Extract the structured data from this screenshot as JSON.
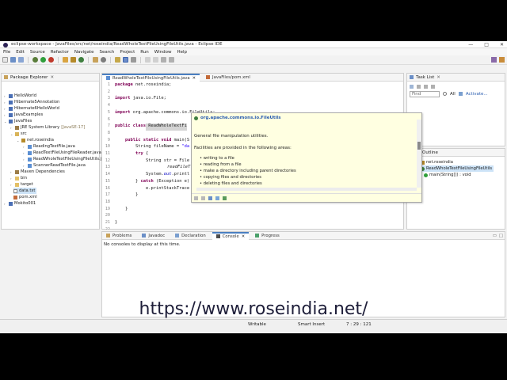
{
  "window": {
    "title": "eclipse-workspace - JavaFiles/src/net/roseindia/ReadWholeTextFileUsingFileUtils.java - Eclipse IDE",
    "controls": [
      "—",
      "□",
      "✕"
    ]
  },
  "menu": [
    "File",
    "Edit",
    "Source",
    "Refactor",
    "Navigate",
    "Search",
    "Project",
    "Run",
    "Window",
    "Help"
  ],
  "package_explorer": {
    "title": "Package Explorer",
    "items": [
      {
        "label": "HelloWorld",
        "decor": ""
      },
      {
        "label": "Hibernate5Annotation",
        "decor": ""
      },
      {
        "label": "Hibernate6HelloWorld",
        "decor": ""
      },
      {
        "label": "JavaExamples",
        "decor": ""
      },
      {
        "label": "JavaFiles",
        "decor": ""
      },
      {
        "label": "JRE System Library",
        "decor": "[JavaSE-17]"
      },
      {
        "label": "src",
        "decor": ""
      },
      {
        "label": "net.roseindia",
        "decor": ""
      },
      {
        "label": "ReadingTextFile.java",
        "decor": ""
      },
      {
        "label": "ReadTextFileUsingFileReader.java",
        "decor": ""
      },
      {
        "label": "ReadWholeTextFileUsingFileUtils.java",
        "decor": ""
      },
      {
        "label": "ScannerReadTextFile.java",
        "decor": ""
      },
      {
        "label": "Maven Dependencies",
        "decor": ""
      },
      {
        "label": "bin",
        "decor": ""
      },
      {
        "label": "target",
        "decor": ""
      },
      {
        "label": "data.txt",
        "decor": ""
      },
      {
        "label": "pom.xml",
        "decor": ""
      },
      {
        "label": "Mokito001",
        "decor": ""
      }
    ]
  },
  "editor": {
    "tabs": [
      "ReadWholeTextFileUsingFileUtils.java",
      "JavaFiles/pom.xml"
    ],
    "line_numbers": [
      "1",
      "2",
      "3",
      "4",
      "5",
      "6",
      "7",
      "8",
      "9",
      "10",
      "11",
      "12",
      "13",
      "14",
      "15",
      "16",
      "17",
      "18",
      "19",
      "20",
      "21",
      "22"
    ],
    "lines": {
      "l1_kw": "package",
      "l1_rest": " net.roseindia;",
      "l3_kw": "import",
      "l3_rest": " java.io.File;",
      "l5_kw": "import",
      "l5_rest": " org.apache.commons.io.FileUtils;",
      "l7_kw1": "public",
      "l7_kw2": " class",
      "l7_rest": " ReadWholeTextFi",
      "l9_kw": "public static void",
      "l9_rest": " main(S",
      "l10_pre": "String fileName = ",
      "l10_str": "\"da",
      "l11_kw": "try",
      "l11_rest": " {",
      "l12_pre": "String str = File",
      "l13_pre": "readFileT",
      "l14_pre": "System.",
      "l14_fld": "out",
      "l14_rest": ".printl",
      "l15_pre": "} ",
      "l15_kw": "catch",
      "l15_rest": " (Exception e)",
      "l16_pre": "e.printStackTrace",
      "l17_pre": "}",
      "l19_pre": "}",
      "l21_pre": "}"
    }
  },
  "hover": {
    "title": "org.apache.commons.io.FileUtils",
    "summary": "General file manipulation utilities.",
    "intro": "Facilities are provided in the following areas:",
    "bullets": [
      "writing to a file",
      "reading from a file",
      "make a directory including parent directories",
      "copying files and directories",
      "deleting files and directories"
    ]
  },
  "task_list": {
    "title": "Task List",
    "find_placeholder": "Find",
    "all_label": "All",
    "activate_label": "Activate..."
  },
  "outline": {
    "title": "Outline",
    "items": [
      "net.roseindia",
      "ReadWholeTextFileUsingFileUtils",
      "main(String[]) : void"
    ]
  },
  "bottom": {
    "tabs": [
      "Problems",
      "Javadoc",
      "Declaration",
      "Console",
      "Progress"
    ],
    "message": "No consoles to display at this time."
  },
  "status": {
    "writable": "Writable",
    "insert": "Smart Insert",
    "position": "7 : 29 : 121"
  },
  "overlay_url": "https://www.roseindia.net/",
  "colors": {
    "keyword": "#7f0055",
    "string": "#2a00ff",
    "field": "#0000c0",
    "popup_bg": "#ffffe1"
  }
}
